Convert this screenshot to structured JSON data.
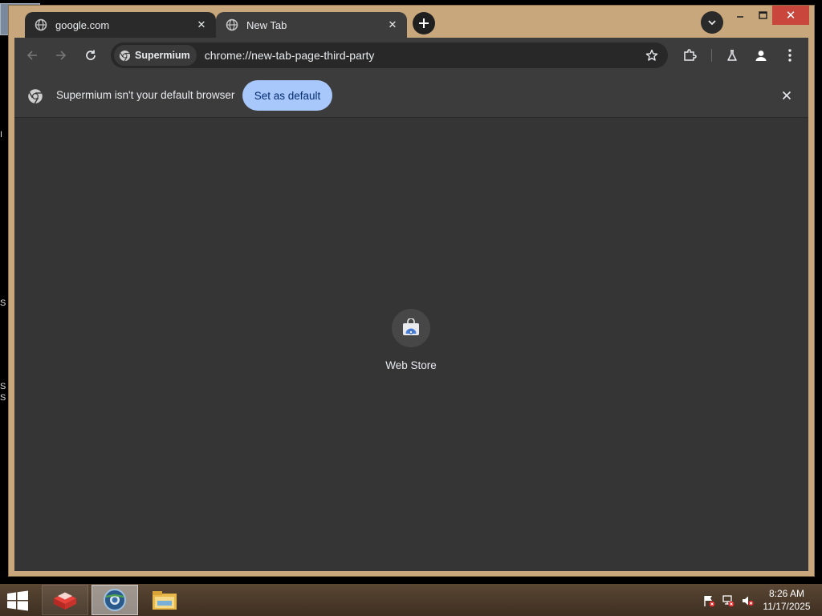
{
  "desktop": {
    "glyphs": [
      "I",
      "S",
      "S",
      "S"
    ]
  },
  "tabs": [
    {
      "title": "google.com",
      "active": false
    },
    {
      "title": "New Tab",
      "active": true
    }
  ],
  "window_controls": {
    "minimize": "—",
    "maximize": "☐",
    "close": "✕"
  },
  "toolbar": {
    "site_chip": "Supermium",
    "url": "chrome://new-tab-page-third-party"
  },
  "infobar": {
    "message": "Supermium isn't your default browser",
    "button_label": "Set as default"
  },
  "shortcuts": [
    {
      "label": "Web Store",
      "icon": "web-store-icon"
    }
  ],
  "taskbar": {
    "time": "8:26 AM",
    "date": "11/17/2025"
  },
  "colors": {
    "frame": "#c9a77c",
    "toolbar": "#3c3c3c",
    "content_bg": "#353535",
    "accent_button": "#a8c7fa",
    "close_red": "#c9463d"
  }
}
